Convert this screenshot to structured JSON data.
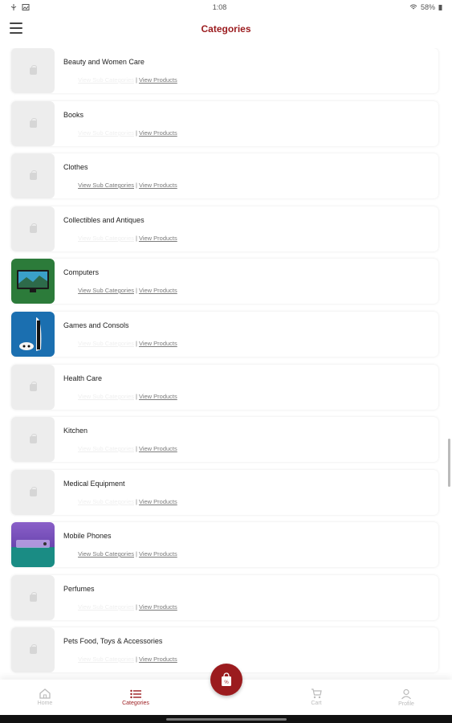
{
  "status_bar": {
    "time": "1:08",
    "battery": "58%"
  },
  "header": {
    "title": "Categories"
  },
  "categories": [
    {
      "name": "Beauty and Women Care",
      "sub_link": "View Sub Categories",
      "view_link": "View Products"
    },
    {
      "name": "Books",
      "sub_link": "View Sub Categories",
      "view_link": "View Products"
    },
    {
      "name": "Clothes",
      "sub_link": "View Sub Categories",
      "view_link": "View Products"
    },
    {
      "name": "Collectibles and Antiques",
      "sub_link": "View Sub Categories",
      "view_link": "View Products"
    },
    {
      "name": "Computers",
      "sub_link": "View Sub Categories",
      "view_link": "View Products"
    },
    {
      "name": "Games and Consols",
      "sub_link": "View Sub Categories",
      "view_link": "View Products"
    },
    {
      "name": "Health Care",
      "sub_link": "View Sub Categories",
      "view_link": "View Products"
    },
    {
      "name": "Kitchen",
      "sub_link": "View Sub Categories",
      "view_link": "View Products"
    },
    {
      "name": "Medical Equipment",
      "sub_link": "View Sub Categories",
      "view_link": "View Products"
    },
    {
      "name": "Mobile Phones",
      "sub_link": "View Sub Categories",
      "view_link": "View Products"
    },
    {
      "name": "Perfumes",
      "sub_link": "View Sub Categories",
      "view_link": "View Products"
    },
    {
      "name": "Pets Food, Toys & Accessories",
      "sub_link": "View Sub Categories",
      "view_link": "View Products"
    }
  ],
  "bottom_nav": {
    "home": "Home",
    "categories": "Categories",
    "cart": "Cart",
    "profile": "Profile"
  },
  "colors": {
    "accent": "#9b1b1e"
  },
  "icons": {
    "menu": "hamburger-menu-icon",
    "home": "home-icon",
    "categories": "list-icon",
    "cart": "cart-icon",
    "profile": "person-icon",
    "fab": "shopping-bag-icon"
  }
}
